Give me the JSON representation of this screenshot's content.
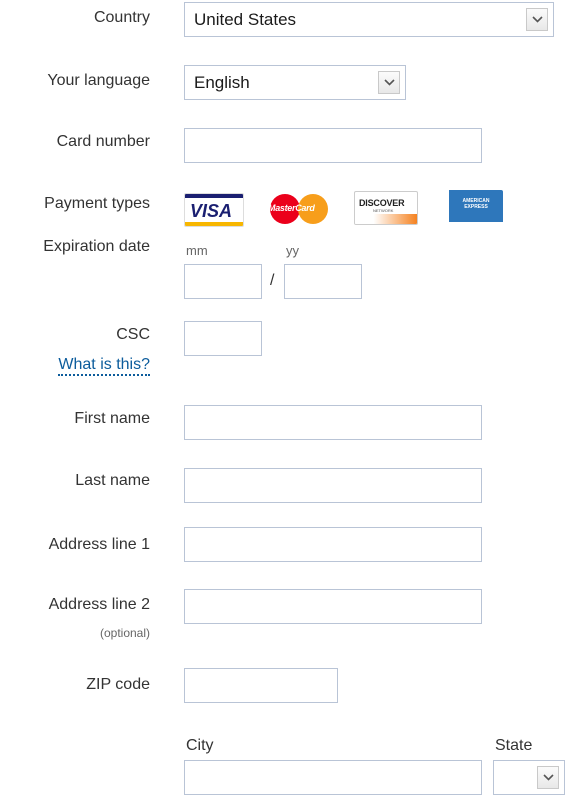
{
  "labels": {
    "country": "Country",
    "language": "Your language",
    "card_number": "Card number",
    "payment_types": "Payment types",
    "expiration_date": "Expiration date",
    "csc": "CSC",
    "what_is_this": "What is this?",
    "first_name": "First name",
    "last_name": "Last name",
    "address_line_1": "Address line 1",
    "address_line_2": "Address line 2",
    "optional": "(optional)",
    "zip_code": "ZIP code",
    "city": "City",
    "state": "State"
  },
  "fields": {
    "country_value": "United States",
    "language_value": "English",
    "card_number": "",
    "exp_month_hint": "mm",
    "exp_year_hint": "yy",
    "exp_separator": "/",
    "csc": "",
    "first_name": "",
    "last_name": "",
    "address_line_1": "",
    "address_line_2": "",
    "zip_code": "",
    "city": "",
    "state_value": ""
  },
  "payment_cards": {
    "visa": "VISA",
    "mastercard": "MasterCard",
    "discover": "DISCOVER",
    "discover_sub": "NETWORK",
    "amex": "AMERICAN EXPRESS"
  },
  "icons": {
    "dropdown": "chevron-down-icon"
  },
  "colors": {
    "link": "#0c5c9c",
    "input_border": "#b9c4d6",
    "visa_blue": "#1a1f71",
    "amex_blue": "#2e77bb",
    "mastercard_red": "#eb001b",
    "mastercard_orange": "#f79e1b",
    "discover_orange": "#f58220"
  }
}
